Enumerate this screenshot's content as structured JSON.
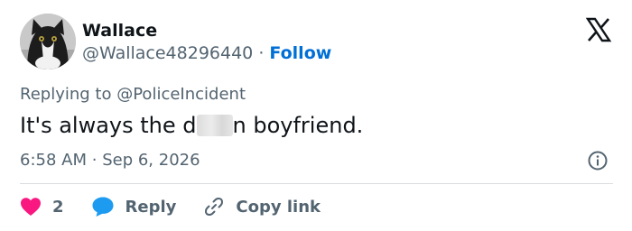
{
  "author": {
    "name": "Wallace",
    "handle": "@Wallace48296440",
    "separator": "·",
    "follow_label": "Follow"
  },
  "reply_context": {
    "prefix": "Replying to",
    "mention": "@PoliceIncident"
  },
  "tweet": {
    "text_before": "It's always the d",
    "text_after": "n boyfriend."
  },
  "meta": {
    "time": "6:58 AM",
    "separator": "·",
    "date": "Sep 6, 2026"
  },
  "actions": {
    "like_count": "2",
    "reply_label": "Reply",
    "copy_label": "Copy link"
  },
  "colors": {
    "like": "#f91880",
    "reply": "#1d9bf0",
    "follow": "#006fd6",
    "muted": "#536471"
  },
  "icons": [
    "x-logo-icon",
    "info-icon",
    "heart-icon",
    "reply-bubble-icon",
    "link-icon"
  ]
}
